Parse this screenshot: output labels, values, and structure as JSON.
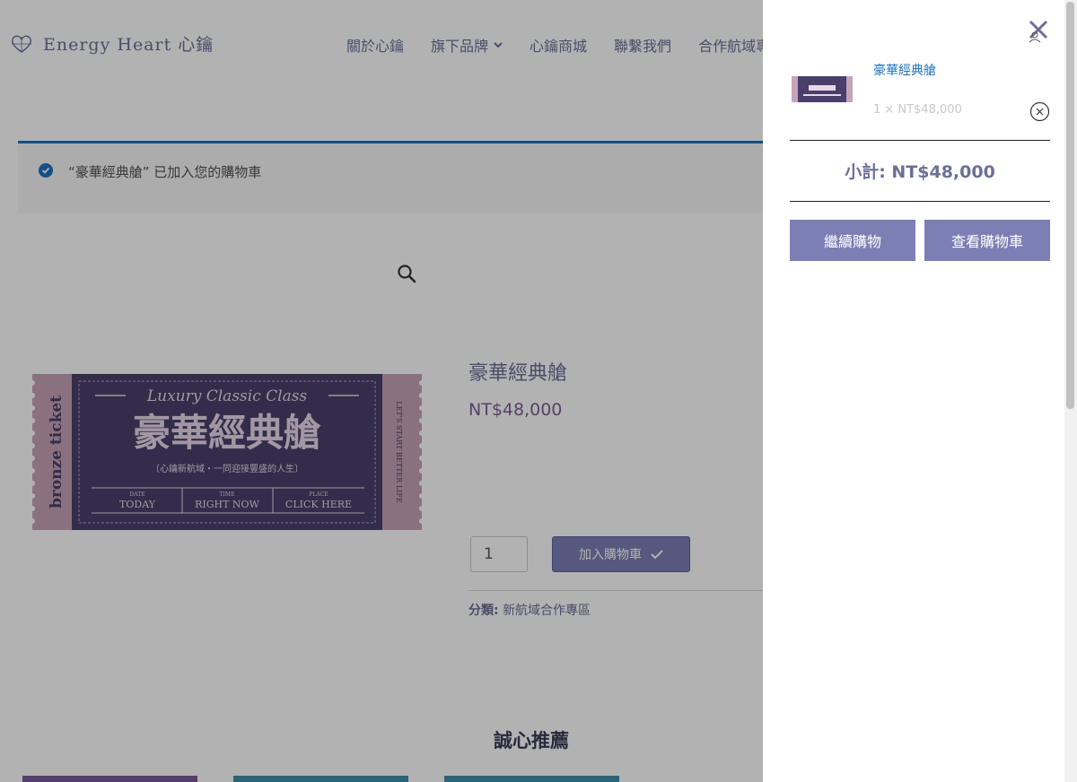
{
  "header": {
    "logo_text": "Energy Heart 心鑰",
    "nav": [
      {
        "label": "關於心鑰"
      },
      {
        "label": "旗下品牌"
      },
      {
        "label": "心鑰商城"
      },
      {
        "label": "聯繫我們"
      },
      {
        "label": "合作航域專區"
      }
    ]
  },
  "notice": {
    "text": "“豪華經典艙” 已加入您的購物車"
  },
  "product": {
    "title": "豪華經典艙",
    "price": "NT$48,000",
    "quantity": "1",
    "add_to_cart_label": "加入購物車",
    "category_label": "分類:",
    "category_value": "新航域合作專區"
  },
  "ticket": {
    "script_title": "Luxury Classic Class",
    "main_title": "豪華經典艙",
    "subtitle": "〔心鑰新航域・一同迎接豐盛的人生〕",
    "side_left": "bronze ticket",
    "side_right": "LET'S START BETTER LIFE",
    "cells": [
      {
        "caption": "DATE",
        "value": "TODAY"
      },
      {
        "caption": "TIME",
        "value": "RIGHT NOW"
      },
      {
        "caption": "PLACE",
        "value": "CLICK HERE"
      }
    ]
  },
  "related": {
    "title": "誠心推薦"
  },
  "cart": {
    "item_name": "豪華經典艙",
    "item_qty": "1 × NT$48,000",
    "subtotal": "小計: NT$48,000",
    "continue_label": "繼續購物",
    "view_cart_label": "查看購物車"
  },
  "colors": {
    "brand": "#6b6f97",
    "button": "#7c7fb4",
    "notice_accent": "#1e73be",
    "ticket_bg": "#4a3f6b",
    "ticket_edge": "#c7a3b8"
  }
}
